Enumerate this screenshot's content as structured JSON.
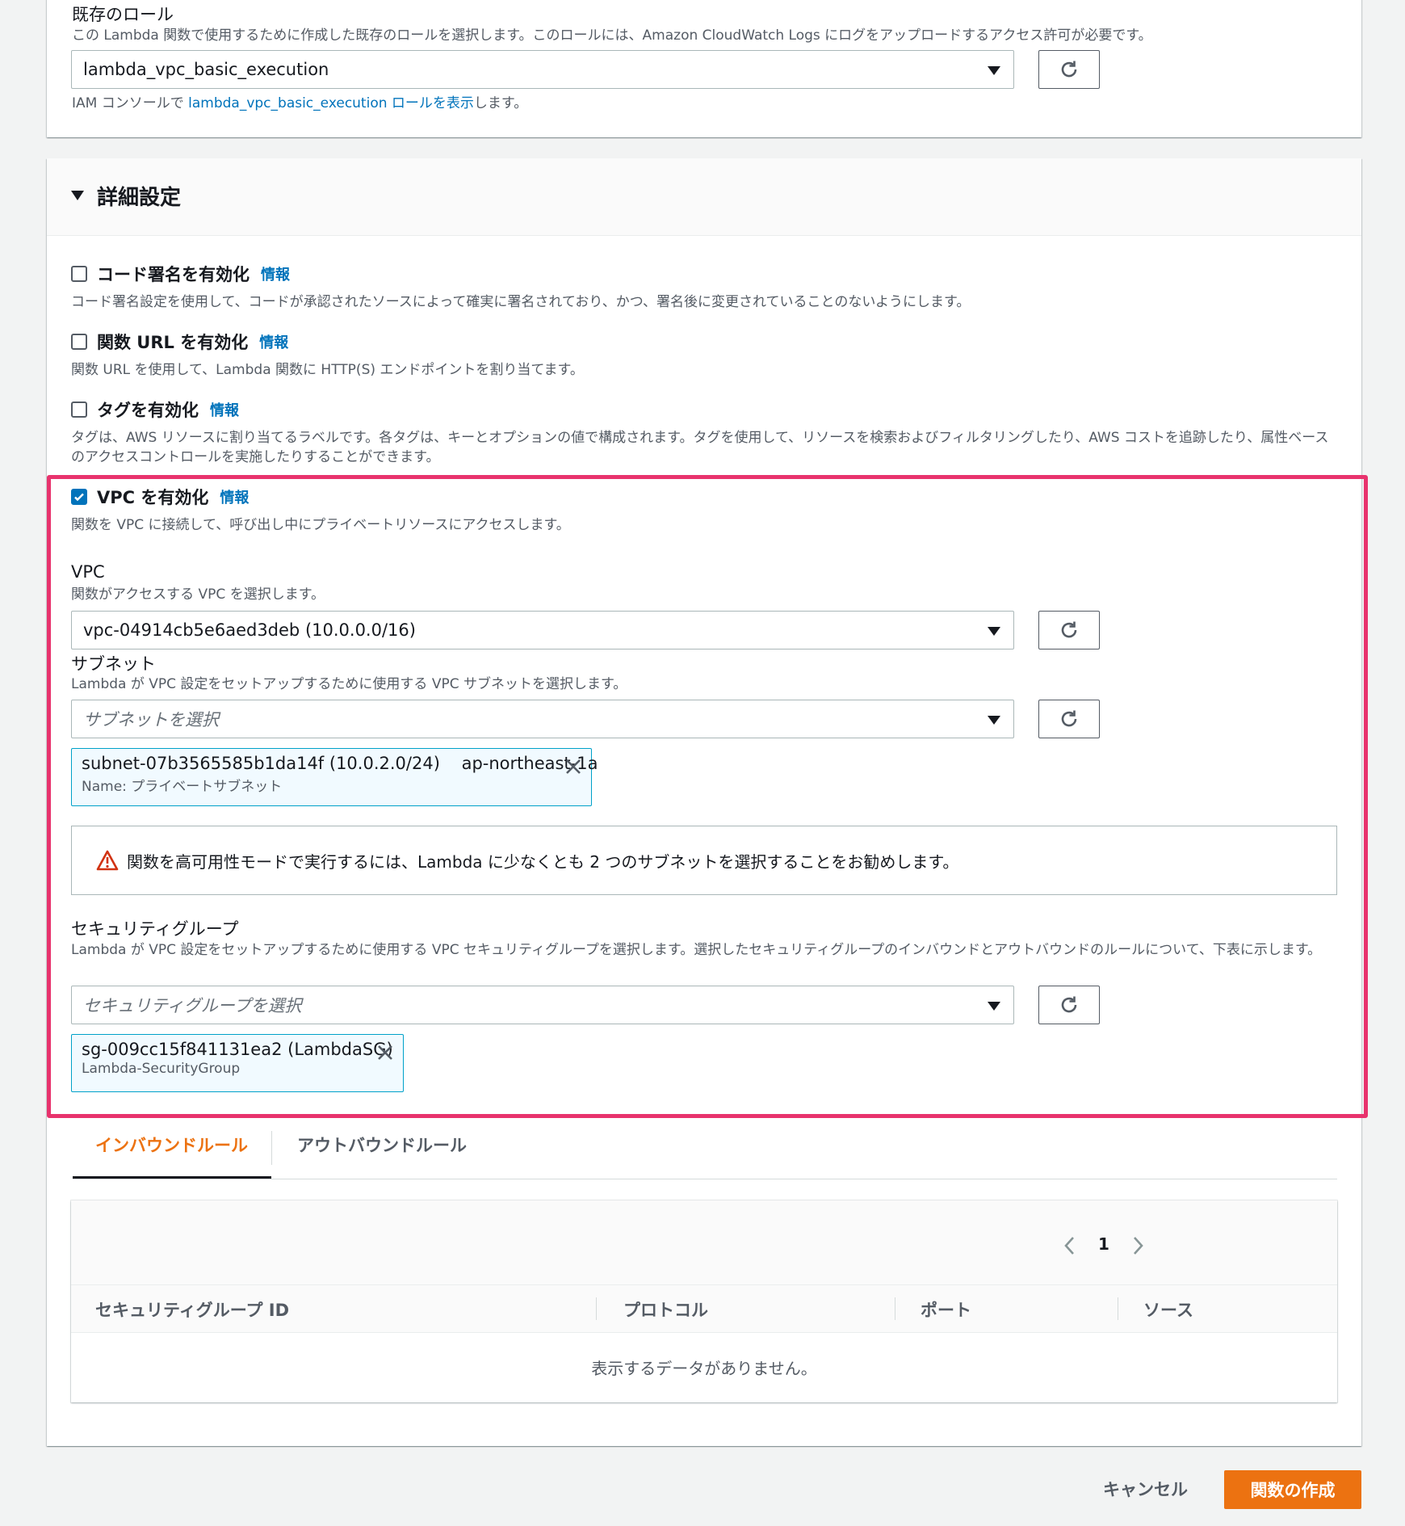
{
  "existing_role": {
    "label": "既存のロール",
    "description": "この Lambda 関数で使用するために作成した既存のロールを選択します。このロールには、Amazon CloudWatch Logs にログをアップロードするアクセス許可が必要です。",
    "selected": "lambda_vpc_basic_execution",
    "hint_prefix": "IAM コンソールで ",
    "hint_link": "lambda_vpc_basic_execution ロールを表示",
    "hint_suffix": "します。"
  },
  "advanced": {
    "title": "詳細設定",
    "info_label": "情報",
    "code_signing": {
      "label": "コード署名を有効化",
      "description": "コード署名設定を使用して、コードが承認されたソースによって確実に署名されており、かつ、署名後に変更されていることのないようにします。",
      "checked": false
    },
    "function_url": {
      "label": "関数 URL を有効化",
      "description": "関数 URL を使用して、Lambda 関数に HTTP(S) エンドポイントを割り当てます。",
      "checked": false
    },
    "tags": {
      "label": "タグを有効化",
      "description": "タグは、AWS リソースに割り当てるラベルです。各タグは、キーとオプションの値で構成されます。タグを使用して、リソースを検索およびフィルタリングしたり、AWS コストを追跡したり、属性ベースのアクセスコントロールを実施したりすることができます。",
      "checked": false
    },
    "vpc_enable": {
      "label": "VPC を有効化",
      "description": "関数を VPC に接続して、呼び出し中にプライベートリソースにアクセスします。",
      "checked": true
    },
    "vpc": {
      "label": "VPC",
      "description": "関数がアクセスする VPC を選択します。",
      "selected": "vpc-04914cb5e6aed3deb (10.0.0.0/16)"
    },
    "subnet": {
      "label": "サブネット",
      "description": "Lambda が VPC 設定をセットアップするために使用する VPC サブネットを選択します。",
      "placeholder": "サブネットを選択",
      "token_main": "subnet-07b3565585b1da14f (10.0.2.0/24)    ap-northeast-1a",
      "token_sub": "Name: プライベートサブネット"
    },
    "warning": "関数を高可用性モードで実行するには、Lambda に少なくとも 2 つのサブネットを選択することをお勧めします。",
    "security_group": {
      "label": "セキュリティグループ",
      "description": "Lambda が VPC 設定をセットアップするために使用する VPC セキュリティグループを選択します。選択したセキュリティグループのインバウンドとアウトバウンドのルールについて、下表に示します。",
      "placeholder": "セキュリティグループを選択",
      "token_main": "sg-009cc15f841131ea2 (LambdaSG)",
      "token_sub": "Lambda-SecurityGroup"
    }
  },
  "rules_tabs": {
    "inbound": "インバウンドルール",
    "outbound": "アウトバウンドルール"
  },
  "rules_table": {
    "page": "1",
    "columns": [
      "セキュリティグループ ID",
      "プロトコル",
      "ポート",
      "ソース"
    ],
    "empty": "表示するデータがありません。"
  },
  "footer": {
    "cancel": "キャンセル",
    "create": "関数の作成"
  },
  "colors": {
    "highlight": "#e8336d",
    "primary": "#ec7211",
    "link": "#0073bb"
  }
}
